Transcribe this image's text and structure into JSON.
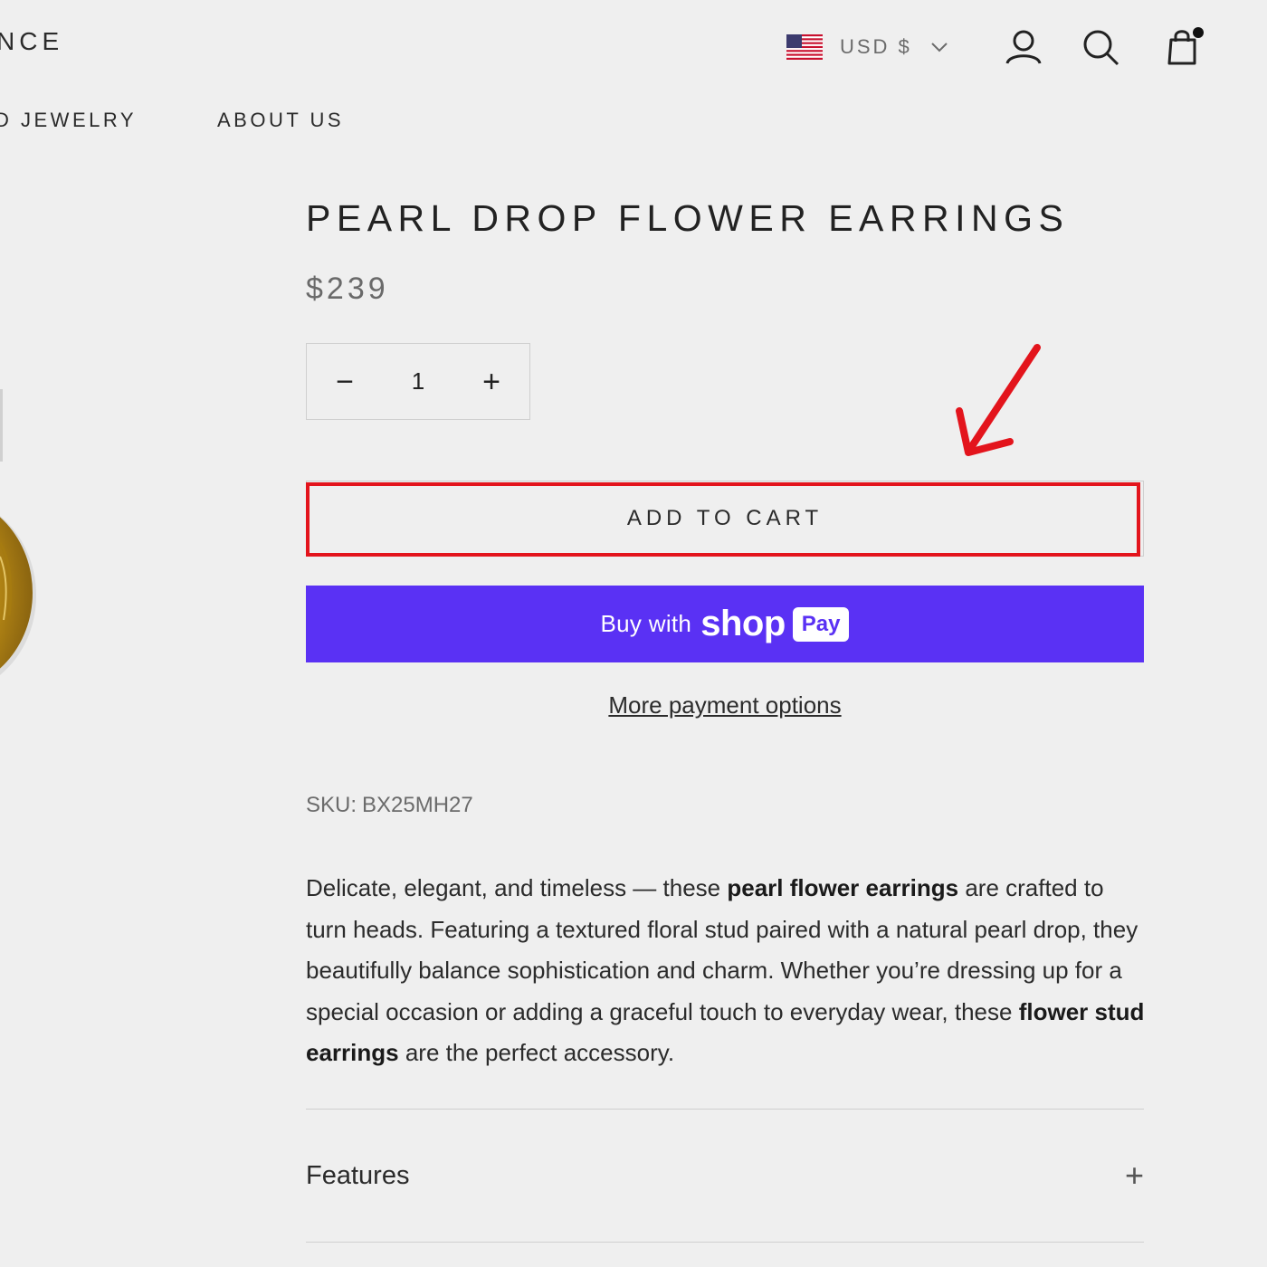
{
  "header": {
    "logo_fragment": "NCE",
    "currency": {
      "label": "USD $"
    },
    "nav": [
      {
        "label": "D JEWELRY"
      },
      {
        "label": "ABOUT US"
      }
    ]
  },
  "product": {
    "title": "PEARL DROP FLOWER EARRINGS",
    "price": "$239",
    "quantity": {
      "value": "1",
      "decrement_symbol": "−",
      "increment_symbol": "+"
    },
    "add_to_cart_label": "ADD TO CART",
    "shop_pay": {
      "buy_text": "Buy with",
      "shop_word": "shop",
      "pay_badge": "Pay"
    },
    "more_payment_label": "More payment options",
    "sku": {
      "label": "SKU:",
      "value": "BX25MH27"
    },
    "description": {
      "p1": "Delicate, elegant, and timeless — these ",
      "b1": "pearl flower earrings",
      "p2": " are crafted to turn heads. Featuring a textured floral stud paired with a natural pearl drop, they beautifully balance sophistication and charm. Whether you’re dressing up for a special occasion or adding a graceful touch to everyday wear, these ",
      "b2": "flower stud earrings",
      "p3": " are the perfect accessory."
    },
    "accordion": [
      {
        "label": "Features",
        "toggle_symbol": "+"
      }
    ]
  },
  "colors": {
    "background": "#efefef",
    "shop_pay_purple": "#5a31f4",
    "annotation_red": "#e3141c",
    "gold": "#d4a017"
  },
  "icons": {
    "flag": "us-flag-icon",
    "chevron": "chevron-down-icon",
    "account": "account-icon",
    "search": "search-icon",
    "cart": "cart-icon",
    "arrow": "red-arrow-annotation"
  }
}
